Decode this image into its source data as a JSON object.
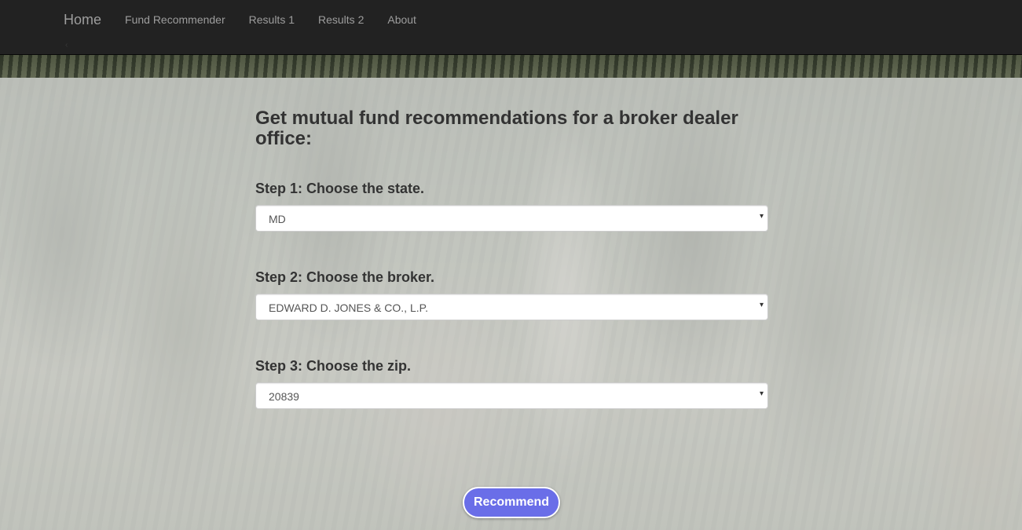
{
  "nav": {
    "brand": "Home",
    "links": [
      "Fund Recommender",
      "Results 1",
      "Results 2",
      "About"
    ],
    "caret": "‹"
  },
  "form": {
    "heading": "Get mutual fund recommendations for a broker dealer office:",
    "steps": [
      {
        "label": "Step 1: Choose the state.",
        "value": "MD"
      },
      {
        "label": "Step 2: Choose the broker.",
        "value": "EDWARD D. JONES & CO., L.P."
      },
      {
        "label": "Step 3: Choose the zip.",
        "value": "20839"
      }
    ],
    "submit_label": "Recommend"
  },
  "colors": {
    "navbar": "#222222",
    "nav_text": "#9d9d9d",
    "button": "#6a6ee8",
    "heading_text": "#333333"
  },
  "icons": {
    "select_arrow": "▾"
  }
}
